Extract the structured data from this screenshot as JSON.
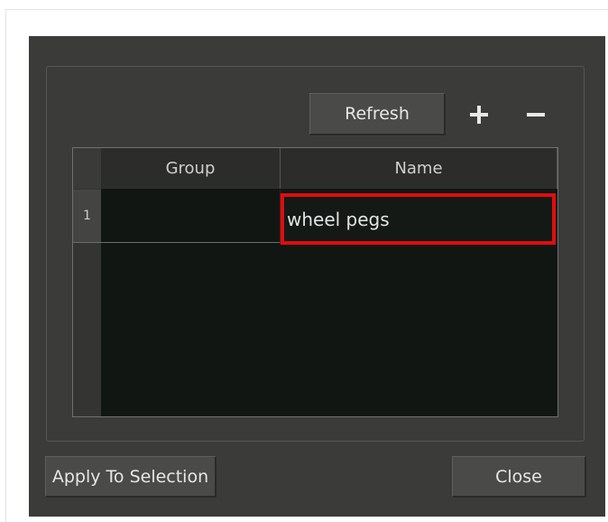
{
  "toolbar": {
    "refresh_label": "Refresh",
    "add_icon": "plus-icon",
    "remove_icon": "minus-icon"
  },
  "table": {
    "columns": [
      "Group",
      "Name"
    ],
    "rows": [
      {
        "index": "1",
        "group": "",
        "name": "wheel pegs"
      }
    ]
  },
  "footer": {
    "apply_label": "Apply To Selection",
    "close_label": "Close"
  },
  "colors": {
    "dialog_bg": "#3b3c3a",
    "table_bg": "#121613",
    "selection_highlight": "#e00d0d"
  }
}
